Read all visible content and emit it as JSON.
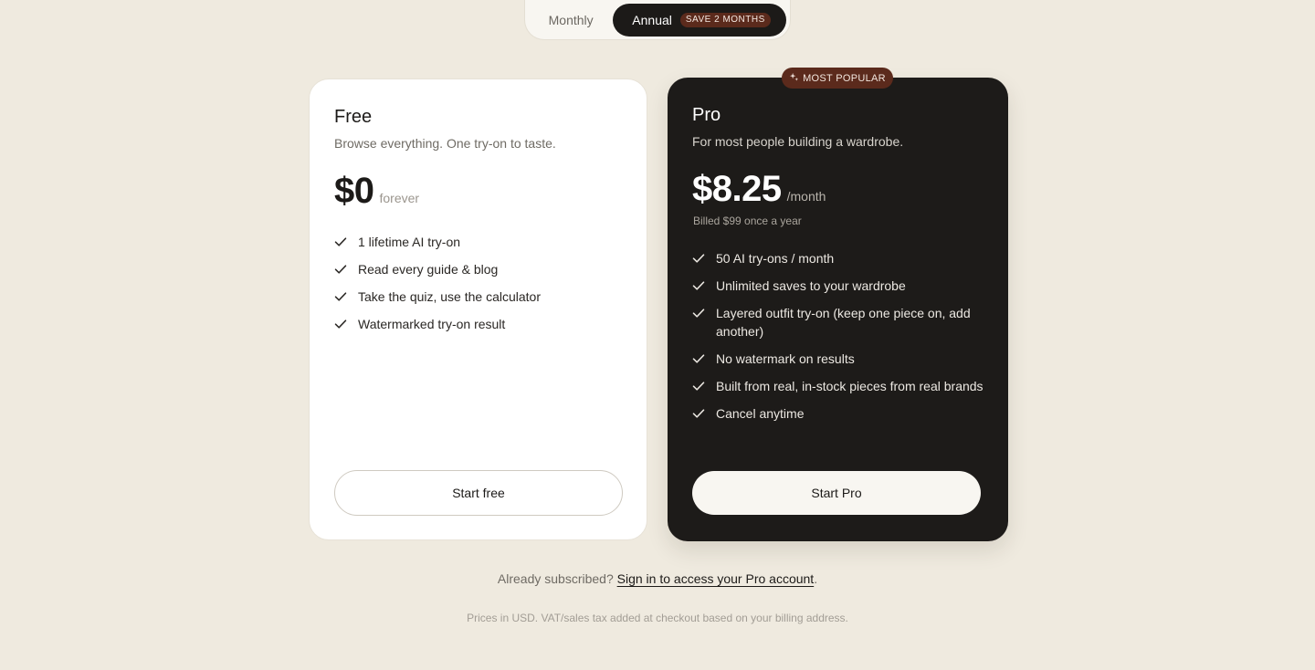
{
  "billing_toggle": {
    "monthly_label": "Monthly",
    "annual_label": "Annual",
    "save_badge": "SAVE 2 MONTHS",
    "selected": "Annual"
  },
  "plans": {
    "free": {
      "name": "Free",
      "description": "Browse everything. One try-on to taste.",
      "price": "$0",
      "period": "forever",
      "features": [
        "1 lifetime AI try-on",
        "Read every guide & blog",
        "Take the quiz, use the calculator",
        "Watermarked try-on result"
      ],
      "cta": "Start free"
    },
    "pro": {
      "badge": "MOST POPULAR",
      "name": "Pro",
      "description": "For most people building a wardrobe.",
      "price": "$8.25",
      "period": "/month",
      "billed_note": "Billed $99 once a year",
      "features": [
        "50 AI try-ons / month",
        "Unlimited saves to your wardrobe",
        "Layered outfit try-on (keep one piece on, add another)",
        "No watermark on results",
        "Built from real, in-stock pieces from real brands",
        "Cancel anytime"
      ],
      "cta": "Start Pro"
    }
  },
  "footer": {
    "signin_prefix": "Already subscribed?",
    "signin_link": "Sign in to access your Pro account",
    "signin_suffix": ".",
    "fineprint": "Prices in USD. VAT/sales tax added at checkout based on your billing address."
  },
  "colors": {
    "background": "#efeadf",
    "pro_card": "#1d1b19",
    "accent_badge": "#5b2a1c"
  },
  "icons": {
    "feature": "check-icon",
    "popular": "sparkle-icon"
  }
}
